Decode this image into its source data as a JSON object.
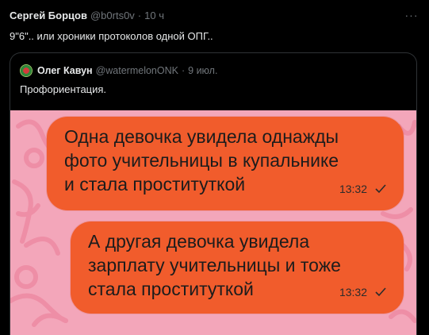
{
  "post": {
    "author_name": "Сергей Борцов",
    "author_handle": "@b0rts0v",
    "separator": "·",
    "time": "10 ч",
    "more_label": "···",
    "text": "9\"6\".. или хроники протоколов одной ОПГ.."
  },
  "quote": {
    "author_name": "Олег Кавун",
    "author_handle": "@watermelonONK",
    "separator": "·",
    "time": "9 июл.",
    "text": "Профориентация."
  },
  "media": {
    "messages": [
      {
        "text": "Одна девочка увидела однажды\nфото учительницы в купальнике\nи стала проституткой",
        "time": "13:32"
      },
      {
        "text": "А другая девочка увидела\nзарплату учительницы и тоже\nстала проституткой",
        "time": "13:32"
      }
    ],
    "icon_read": "check-icon",
    "colors": {
      "background": "#f3a6ba",
      "bubble": "#f15c2c"
    }
  }
}
